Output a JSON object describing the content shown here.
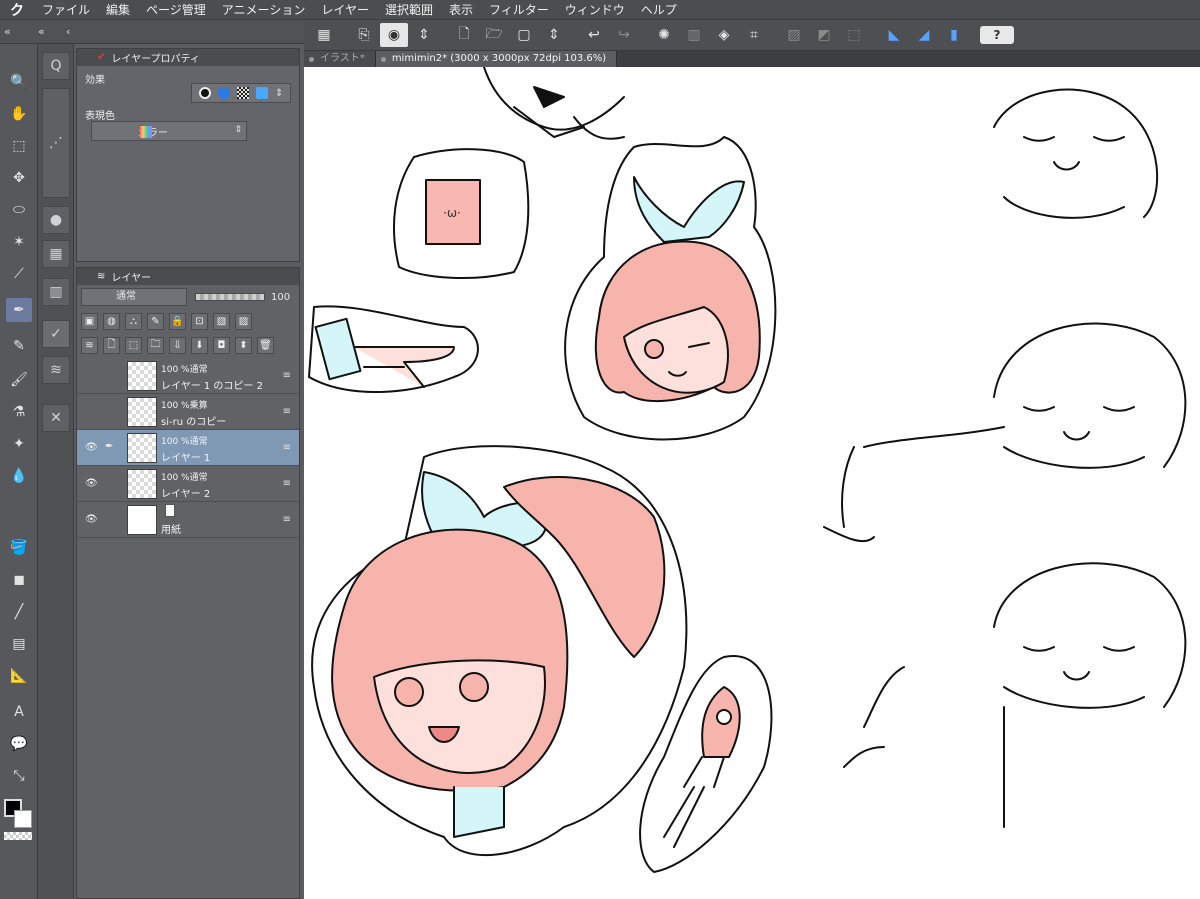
{
  "menu": {
    "logo": "ク",
    "items": [
      "ファイル",
      "編集",
      "ページ管理",
      "アニメーション",
      "レイヤー",
      "選択範囲",
      "表示",
      "フィルター",
      "ウィンドウ",
      "ヘルプ"
    ]
  },
  "toolbar": {
    "help_label": "?"
  },
  "tabs": [
    {
      "label": "イラスト*"
    },
    {
      "label": "mimimin2* (3000 x 3000px 72dpi 103.6%)"
    }
  ],
  "property_panel": {
    "title": "レイヤープロパティ",
    "effect_label": "効果",
    "expression_label": "表現色",
    "color_mode": "カラー"
  },
  "layer_panel": {
    "title": "レイヤー",
    "blend_mode": "通常",
    "opacity": "100",
    "layers": [
      {
        "line1": "100 %通常",
        "line2": "レイヤー 1 のコピー 2"
      },
      {
        "line1": "100 %乗算",
        "line2": "si-ru のコピー"
      },
      {
        "line1": "100 %通常",
        "line2": "レイヤー 1"
      },
      {
        "line1": "100 %通常",
        "line2": "レイヤー 2"
      },
      {
        "line1": "",
        "line2": "用紙"
      }
    ]
  },
  "colors": {
    "hair": "#f6b4ad",
    "ribbon": "#d4f6f8",
    "skin": "#fde0db",
    "selected_layer": "#7f99b5"
  }
}
